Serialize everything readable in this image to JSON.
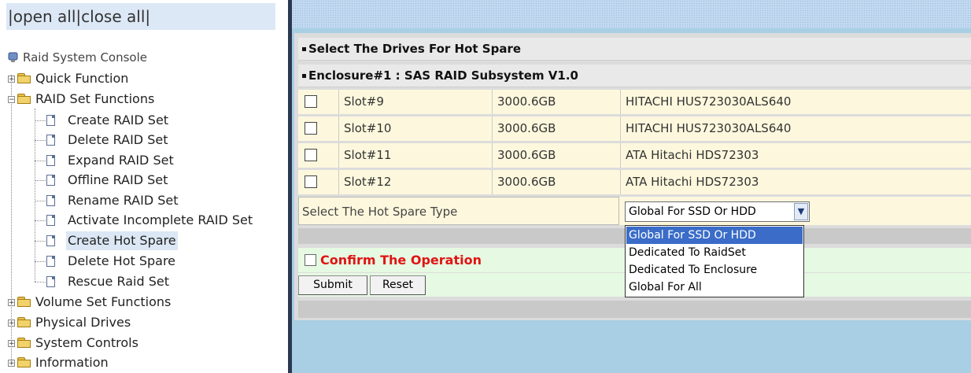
{
  "topbar": {
    "open_all": "open all",
    "close_all": "close all",
    "sep": "|"
  },
  "tree": {
    "root": "Raid System Console",
    "quick": "Quick Function",
    "raidset": "RAID Set Functions",
    "raidset_items": [
      "Create RAID Set",
      "Delete RAID Set",
      "Expand RAID Set",
      "Offline RAID Set",
      "Rename RAID Set",
      "Activate Incomplete RAID Set",
      "Create Hot Spare",
      "Delete Hot Spare",
      "Rescue Raid Set"
    ],
    "selected_item": "Create Hot Spare",
    "volume": "Volume Set Functions",
    "physical": "Physical Drives",
    "system": "System Controls",
    "info": "Information"
  },
  "panel": {
    "title": "Select The Drives For Hot Spare",
    "enclosure": "Enclosure#1 : SAS RAID Subsystem V1.0",
    "drives": [
      {
        "slot": "Slot#9",
        "size": "3000.6GB",
        "model": "HITACHI HUS723030ALS640"
      },
      {
        "slot": "Slot#10",
        "size": "3000.6GB",
        "model": "HITACHI HUS723030ALS640"
      },
      {
        "slot": "Slot#11",
        "size": "3000.6GB",
        "model": "ATA Hitachi HDS72303"
      },
      {
        "slot": "Slot#12",
        "size": "3000.6GB",
        "model": "ATA Hitachi HDS72303"
      }
    ],
    "hotspare_label": "Select The Hot Spare Type",
    "hotspare_selected": "Global For SSD Or HDD",
    "hotspare_options": [
      "Global For SSD Or HDD",
      "Dedicated To RaidSet",
      "Dedicated To Enclosure",
      "Global For All"
    ],
    "confirm": "Confirm The Operation",
    "submit": "Submit",
    "reset": "Reset"
  },
  "colors": {
    "confirm_text": "#e01414",
    "row_bg": "#fdf8dd",
    "confirm_bg": "#e6f9e2",
    "right_bg": "#a8cfe3",
    "highlight": "#3a6cc8"
  }
}
